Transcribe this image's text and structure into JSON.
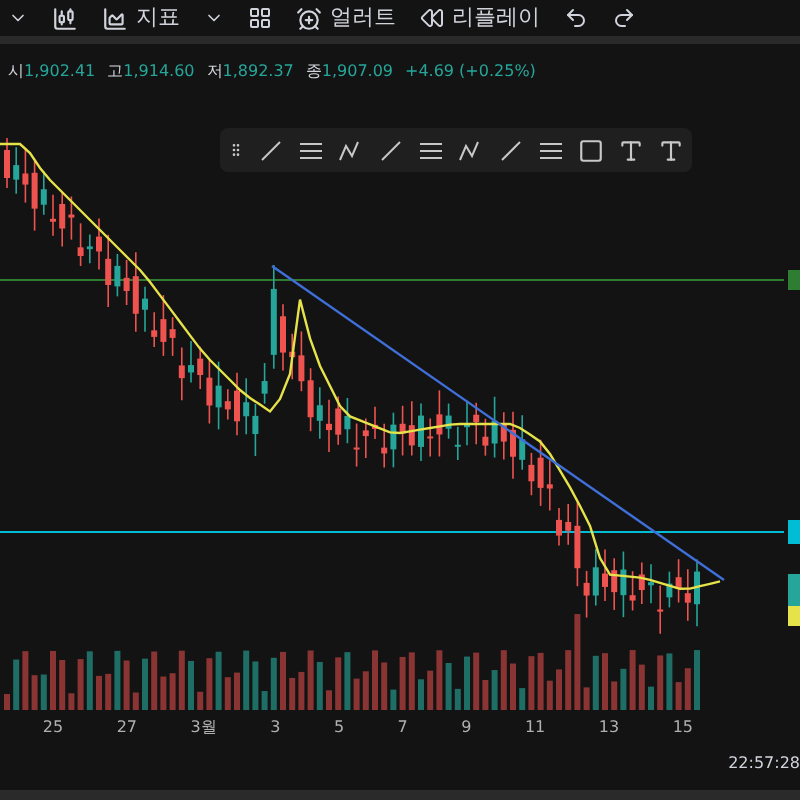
{
  "toolbar": {
    "indicators": "지표",
    "alert": "얼러트",
    "replay": "리플레이"
  },
  "legend": [
    {
      "label": "시",
      "value": "1,902.41"
    },
    {
      "label": "고",
      "value": "1,914.60"
    },
    {
      "label": "저",
      "value": "1,892.37"
    },
    {
      "label": "종",
      "value": "1,907.09"
    }
  ],
  "change": "+4.69 (+0.25%)",
  "x_axis": [
    "25",
    "27",
    "3월",
    "3",
    "5",
    "7",
    "9",
    "11",
    "13",
    "15"
  ],
  "clock": "22:57:28"
}
